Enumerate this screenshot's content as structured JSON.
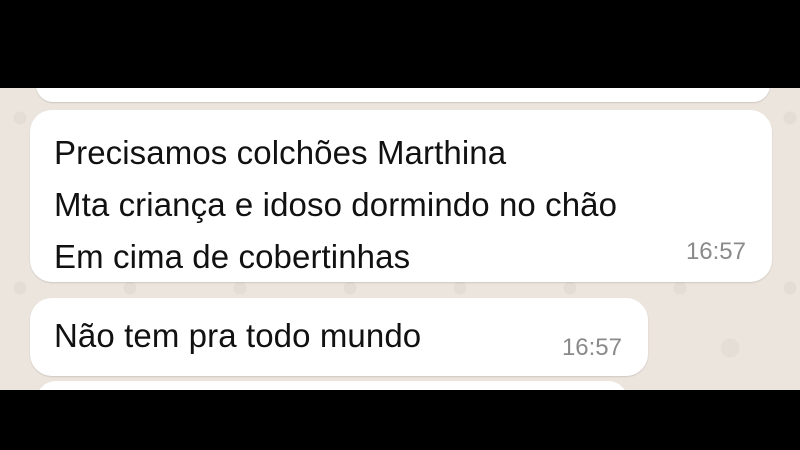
{
  "conversation": {
    "messages": [
      {
        "lines": [
          "Precisamos colchões Marthina",
          "Mta criança e idoso dormindo no chão",
          "Em cima de cobertinhas"
        ],
        "time": "16:57"
      },
      {
        "lines": [
          "Não tem pra todo mundo"
        ],
        "time": "16:57"
      }
    ]
  },
  "colors": {
    "chat_background": "#ECE5DD",
    "bubble": "#FFFFFF",
    "text": "#111111",
    "timestamp": "#8A8A8A",
    "letterbox": "#000000"
  }
}
